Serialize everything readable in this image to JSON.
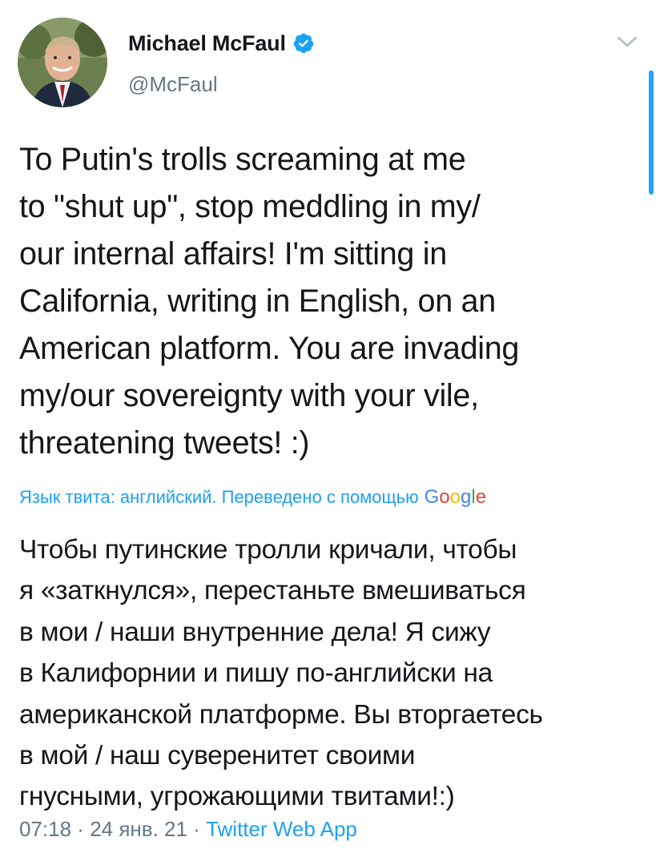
{
  "author": {
    "display_name": "Michael McFaul",
    "handle": "@McFaul",
    "verified": true,
    "avatar_icon": "profile-photo"
  },
  "tweet": {
    "text": "To Putin's trolls screaming at me\nto \"shut up\", stop meddling in my/\nour internal affairs!  I'm sitting in\nCalifornia, writing in English, on an\nAmerican platform. You are invading\nmy/our  sovereignty with your vile,\nthreatening tweets! :)"
  },
  "translation": {
    "note": "Язык твита: английский. Переведено с помощью",
    "provider": "Google",
    "text": "Чтобы путинские тролли кричали, чтобы\nя «заткнулся», перестаньте вмешиваться\nв мои / наши внутренние дела! Я сижу\nв Калифорнии и пишу по-английски на\nамериканской платформе. Вы вторгаетесь\nв мой / наш суверенитет своими\nгнусными, угрожающими твитами!:)"
  },
  "meta": {
    "time": "07:18",
    "separator": " · ",
    "date": "24 янв. 21",
    "source": "Twitter Web App"
  },
  "colors": {
    "accent": "#1da1f2",
    "secondary_text": "#657786",
    "primary_text": "#14171a"
  }
}
